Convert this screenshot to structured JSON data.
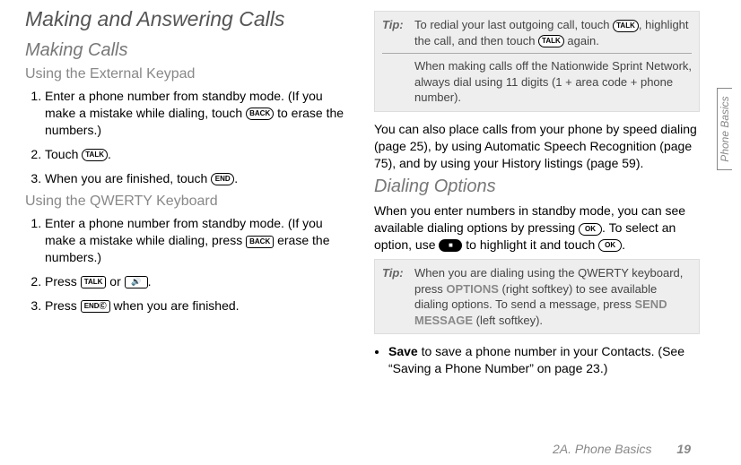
{
  "keys": {
    "back": "BACK",
    "talk": "TALK",
    "end": "END",
    "ok": "OK",
    "endO": "ENDⒸ",
    "speaker": " "
  },
  "left": {
    "h1": "Making and Answering Calls",
    "h2": "Making Calls",
    "h3a": "Using the External Keypad",
    "a1_pre": "Enter a phone number from standby mode. (If you make a mistake while dialing, touch ",
    "a1_post": " to erase the numbers.)",
    "a2_pre": "Touch ",
    "a2_post": ".",
    "a3_pre": "When you are finished, touch ",
    "a3_post": ".",
    "h3b": "Using the QWERTY Keyboard",
    "b1_pre": "Enter a phone number from standby mode. (If you make a mistake while dialing, press ",
    "b1_post": " erase the numbers.)",
    "b2_pre": "Press ",
    "b2_mid": " or ",
    "b2_post": ".",
    "b3_pre": "Press ",
    "b3_post": " when you are finished."
  },
  "right": {
    "tip1_label": "Tip:",
    "tip1a_pre": "To redial your last outgoing call, touch ",
    "tip1a_mid": ", highlight the call, and then touch ",
    "tip1a_post": " again.",
    "tip1b": "When making calls off the Nationwide Sprint Network, always dial using 11 digits (1 + area code + phone number).",
    "para1": "You can also place calls from your phone by speed dialing (page 25), by using Automatic Speech Recognition (page 75), and by using your History listings (page 59).",
    "h2b": "Dialing Options",
    "para2_pre": "When you enter numbers in standby mode, you can see available dialing options by pressing ",
    "para2_mid": ". To select an option, use ",
    "para2_mid2": " to highlight it and touch ",
    "para2_post": ".",
    "tip2_label": "Tip:",
    "tip2_pre": "When you are dialing using the QWERTY keyboard, press ",
    "tip2_soft1": "OPTIONS",
    "tip2_mid": " (right softkey) to see available dialing options. To send a message, press ",
    "tip2_soft2": "SEND MESSAGE",
    "tip2_post": " (left softkey).",
    "bullet_lead": "Save",
    "bullet_rest": " to save a phone number in your Contacts. (See “Saving a Phone Number” on page 23.)"
  },
  "footer": {
    "chapter": "2A. Phone Basics",
    "page": "19"
  },
  "sideTab": "Phone Basics",
  "nav_square": "■"
}
